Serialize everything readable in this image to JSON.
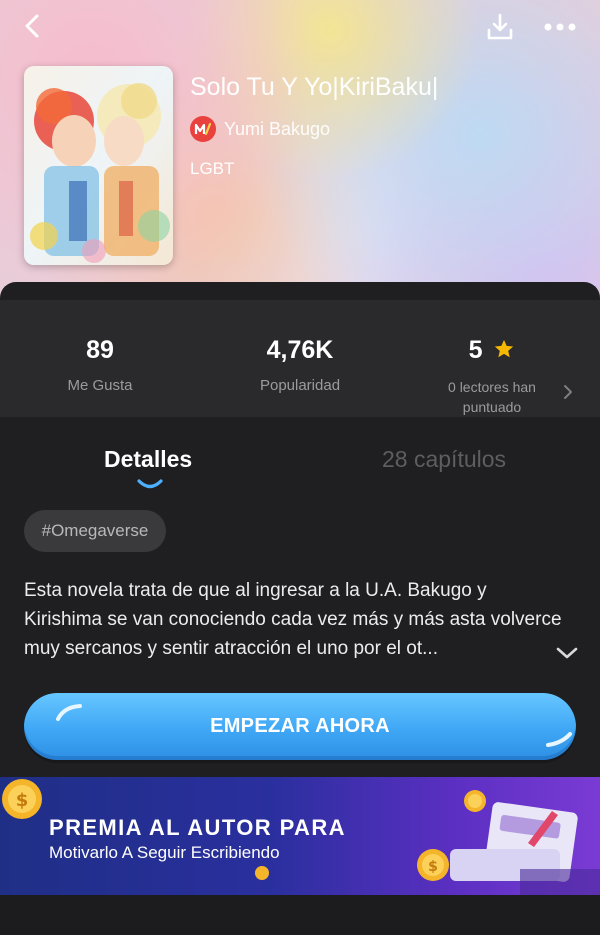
{
  "book": {
    "title": "Solo Tu Y Yo|KiriBaku|",
    "author": "Yumi Bakugo",
    "genre": "LGBT"
  },
  "stats": [
    {
      "value": "89",
      "label": "Me Gusta"
    },
    {
      "value": "4,76K",
      "label": "Popularidad"
    },
    {
      "value": "5",
      "label": "0 lectores han puntuado"
    }
  ],
  "tabs": {
    "details": "Detalles",
    "chapters": "28 capítulos"
  },
  "tag": "#Omegaverse",
  "description": "Esta novela trata de que al ingresar a la U.A. Bakugo y Kirishima se van conociendo cada vez más y más asta volverce muy sercanos y sentir atracción el uno por el ot...",
  "cta_label": "EMPEZAR AHORA",
  "banner": {
    "title": "PREMIA AL AUTOR PARA",
    "subtitle": "Motivarlo A Seguir Escribiendo"
  },
  "icons": {
    "back": "chevron-left-icon",
    "download": "download-icon",
    "more": "more-horizontal-icon",
    "star": "star-icon",
    "chevron_right": "chevron-right-icon",
    "chevron_down": "chevron-down-icon"
  },
  "colors": {
    "accent_blue": "#3fa7f5",
    "star_gold": "#f5b700",
    "author_badge": "#e8413e",
    "banner_purple": "#5a2fc1"
  }
}
